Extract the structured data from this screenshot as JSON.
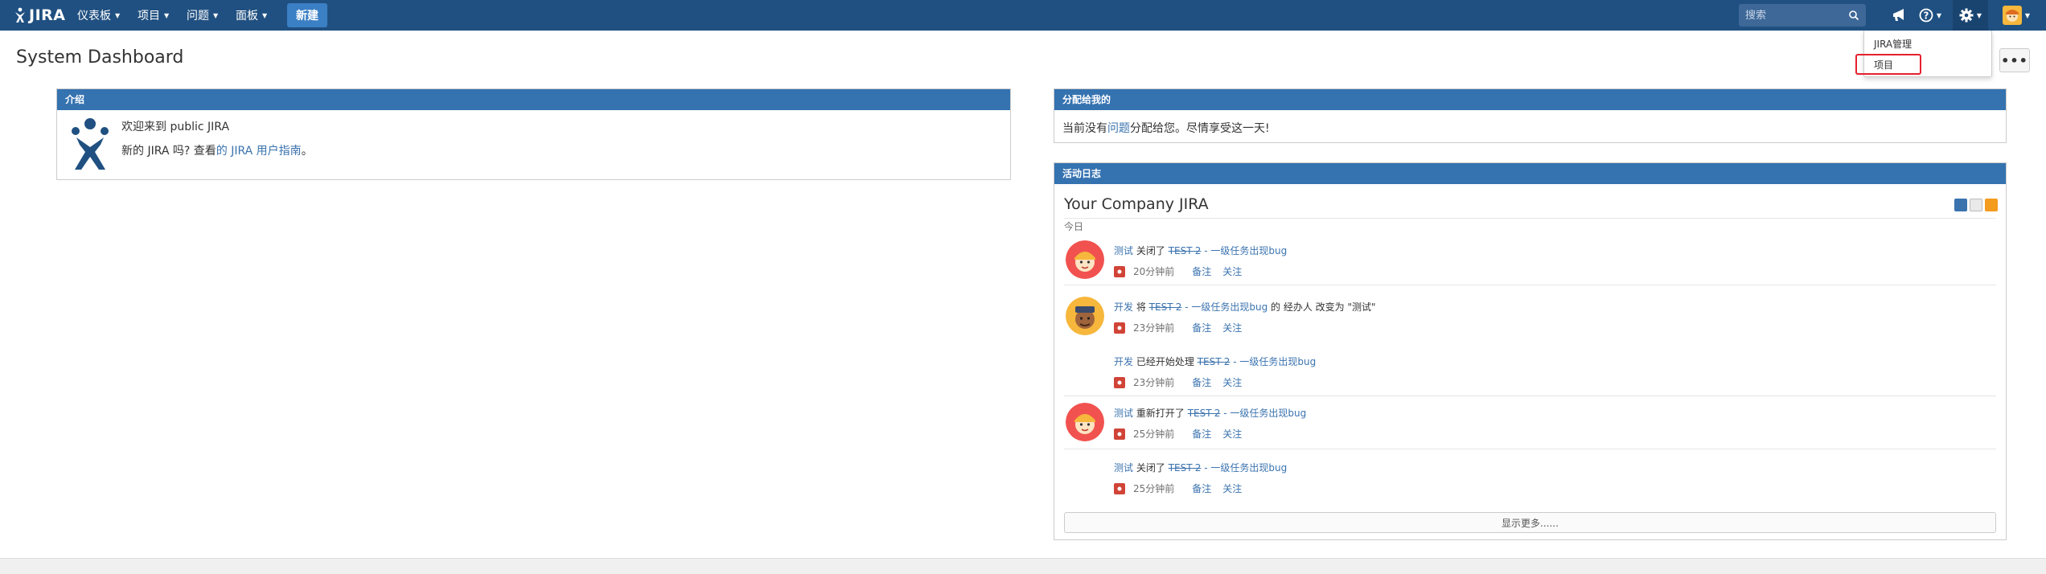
{
  "topbar": {
    "logo_text": "JIRA",
    "nav": [
      {
        "label": "仪表板"
      },
      {
        "label": "项目"
      },
      {
        "label": "问题"
      },
      {
        "label": "面板"
      }
    ],
    "create_label": "新建",
    "search_placeholder": "搜索",
    "icons": [
      "feedback-megaphone-icon",
      "help-icon",
      "gear-icon",
      "user-avatar-icon"
    ]
  },
  "admin_menu": {
    "items": [
      "JIRA管理",
      "项目"
    ]
  },
  "header": {
    "title": "System Dashboard",
    "more_label": "•••"
  },
  "intro": {
    "title": "介绍",
    "welcome": "欢迎来到 public JIRA",
    "new_prefix": "新的 JIRA 吗? 查看",
    "guide_link": "的 JIRA 用户指南",
    "suffix": "。"
  },
  "assigned": {
    "title": "分配给我的",
    "text_prefix": "当前没有",
    "link": "问题",
    "text_suffix": "分配给您。尽情享受这一天!"
  },
  "activity": {
    "title": "活动日志",
    "stream_title": "Your Company JIRA",
    "date_group": "今日",
    "entries": [
      {
        "actor": "测试",
        "verb": "关闭了",
        "key": "TEST-2",
        "summary": " - 一级任务出现bug",
        "extra": "",
        "time": "20分钟前",
        "comment": "备注",
        "watch": "关注",
        "avatar": "tester"
      },
      {
        "actor": "开发",
        "verb": "将",
        "key": "TEST-2",
        "summary": " - 一级任务出现bug",
        "extra": " 的 经办人 改变为 \"测试\"",
        "time": "23分钟前",
        "comment": "备注",
        "watch": "关注",
        "avatar": "dev"
      },
      {
        "actor": "开发",
        "verb": "已经开始处理",
        "key": "TEST-2",
        "summary": " - 一级任务出现bug",
        "extra": "",
        "time": "23分钟前",
        "comment": "备注",
        "watch": "关注",
        "avatar": ""
      },
      {
        "actor": "测试",
        "verb": "重新打开了",
        "key": "TEST-2",
        "summary": " - 一级任务出现bug",
        "extra": "",
        "time": "25分钟前",
        "comment": "备注",
        "watch": "关注",
        "avatar": "tester"
      },
      {
        "actor": "测试",
        "verb": "关闭了",
        "key": "TEST-2",
        "summary": " - 一级任务出现bug",
        "extra": "",
        "time": "25分钟前",
        "comment": "备注",
        "watch": "关注",
        "avatar": ""
      }
    ],
    "show_more": "显示更多......"
  },
  "colors": {
    "topbar": "#205081",
    "gadget_header": "#3572b0",
    "link": "#3b73af",
    "highlight": "#e5202d"
  }
}
